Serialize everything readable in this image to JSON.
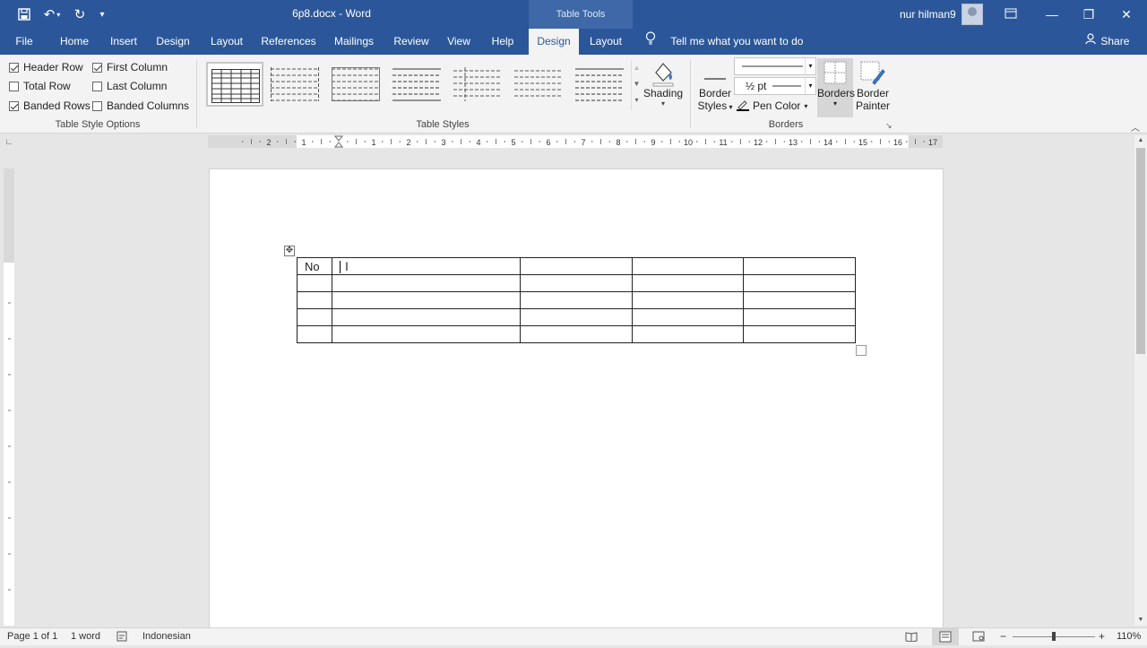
{
  "titlebar": {
    "doc_title": "6p8.docx  -  Word",
    "contextual_tab_group": "Table Tools",
    "user_name": "nur hilman9"
  },
  "tabs": [
    "File",
    "Home",
    "Insert",
    "Design",
    "Layout",
    "References",
    "Mailings",
    "Review",
    "View",
    "Help",
    "Design",
    "Layout"
  ],
  "active_tab": "Design",
  "tell_me": "Tell me what you want to do",
  "share": "Share",
  "table_style_options": {
    "group_label": "Table Style Options",
    "header_row": {
      "label": "Header Row",
      "checked": true
    },
    "first_column": {
      "label": "First Column",
      "checked": true
    },
    "total_row": {
      "label": "Total Row",
      "checked": false
    },
    "last_column": {
      "label": "Last Column",
      "checked": false
    },
    "banded_rows": {
      "label": "Banded Rows",
      "checked": true
    },
    "banded_columns": {
      "label": "Banded Columns",
      "checked": false
    }
  },
  "table_styles": {
    "group_label": "Table Styles"
  },
  "shading": {
    "label": "Shading"
  },
  "borders": {
    "group_label": "Borders",
    "border_styles_line1": "Border",
    "border_styles_line2": "Styles",
    "pen_weight": "½ pt",
    "pen_color": "Pen Color",
    "borders_label": "Borders",
    "border_painter_line1": "Border",
    "border_painter_line2": "Painter"
  },
  "document": {
    "table": [
      [
        "No",
        "",
        "",
        "",
        ""
      ],
      [
        "",
        "",
        "",
        "",
        ""
      ],
      [
        "",
        "",
        "",
        "",
        ""
      ],
      [
        "",
        "",
        "",
        "",
        ""
      ],
      [
        "",
        "",
        "",
        "",
        ""
      ]
    ]
  },
  "ruler_labels": [
    "2",
    "1",
    "1",
    "2",
    "3",
    "4",
    "5",
    "6",
    "7",
    "8",
    "9",
    "10",
    "11",
    "12",
    "13",
    "14",
    "15",
    "16",
    "17",
    "18"
  ],
  "status": {
    "page": "Page 1 of 1",
    "words": "1 word",
    "language": "Indonesian",
    "zoom": "110%"
  }
}
